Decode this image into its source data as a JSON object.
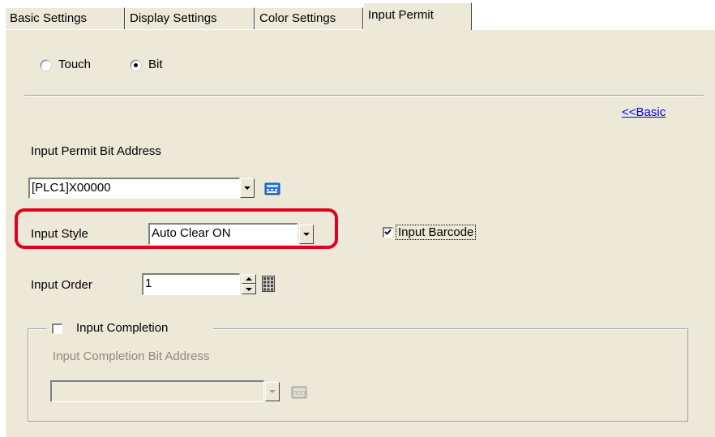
{
  "tabs": [
    {
      "label": "Basic Settings"
    },
    {
      "label": "Display Settings"
    },
    {
      "label": "Color Settings"
    },
    {
      "label": "Input Permit"
    }
  ],
  "trigger": {
    "options": [
      {
        "label": "Touch",
        "selected": false
      },
      {
        "label": "Bit",
        "selected": true
      }
    ]
  },
  "basic_link": "<<Basic",
  "permit_bit_address": {
    "label": "Input Permit Bit Address",
    "value": "[PLC1]X00000"
  },
  "input_style": {
    "label": "Input Style",
    "value": "Auto Clear ON"
  },
  "input_barcode": {
    "label": "Input Barcode",
    "checked": true
  },
  "input_order": {
    "label": "Input Order",
    "value": "1"
  },
  "input_completion": {
    "label": "Input Completion",
    "checked": false,
    "bit_address_label": "Input Completion Bit Address",
    "bit_address_value": ""
  },
  "colors": {
    "highlight": "#e3001b",
    "panel": "#ece9d8",
    "link": "#0000ee"
  }
}
